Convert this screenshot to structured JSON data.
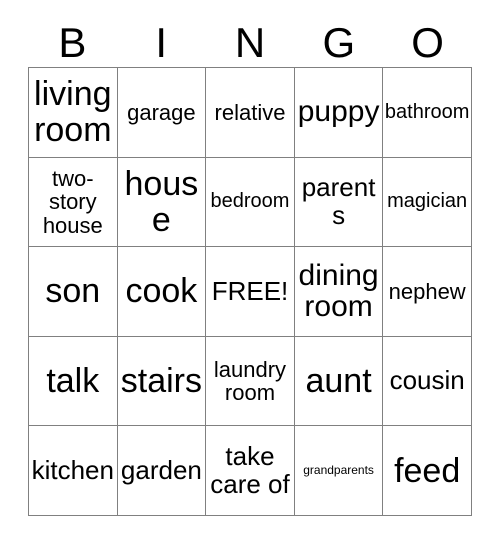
{
  "card": {
    "header_letters": [
      "B",
      "I",
      "N",
      "G",
      "O"
    ],
    "colors": {
      "background": "#ffffff",
      "text": "#000000",
      "grid_line": "#808080"
    },
    "rows": [
      [
        {
          "text": "living room",
          "size": "fs-xl"
        },
        {
          "text": "garage",
          "size": "fs-sm"
        },
        {
          "text": "relative",
          "size": "fs-sm"
        },
        {
          "text": "puppy",
          "size": "fs-lg"
        },
        {
          "text": "bathroom",
          "size": "fs-xs"
        }
      ],
      [
        {
          "text": "two-story house",
          "size": "fs-sm"
        },
        {
          "text": "house",
          "size": "fs-xl"
        },
        {
          "text": "bedroom",
          "size": "fs-xs"
        },
        {
          "text": "parents",
          "size": "fs-md"
        },
        {
          "text": "magician",
          "size": "fs-xs"
        }
      ],
      [
        {
          "text": "son",
          "size": "fs-xl"
        },
        {
          "text": "cook",
          "size": "fs-xl"
        },
        {
          "text": "FREE!",
          "size": "fs-md"
        },
        {
          "text": "dining room",
          "size": "fs-lg"
        },
        {
          "text": "nephew",
          "size": "fs-sm"
        }
      ],
      [
        {
          "text": "talk",
          "size": "fs-xl"
        },
        {
          "text": "stairs",
          "size": "fs-xl"
        },
        {
          "text": "laundry room",
          "size": "fs-sm"
        },
        {
          "text": "aunt",
          "size": "fs-xl"
        },
        {
          "text": "cousin",
          "size": "fs-md"
        }
      ],
      [
        {
          "text": "kitchen",
          "size": "fs-md"
        },
        {
          "text": "garden",
          "size": "fs-md"
        },
        {
          "text": "take care of",
          "size": "fs-md"
        },
        {
          "text": "grandparents",
          "size": "fs-tiny"
        },
        {
          "text": "feed",
          "size": "fs-xl"
        }
      ]
    ]
  }
}
